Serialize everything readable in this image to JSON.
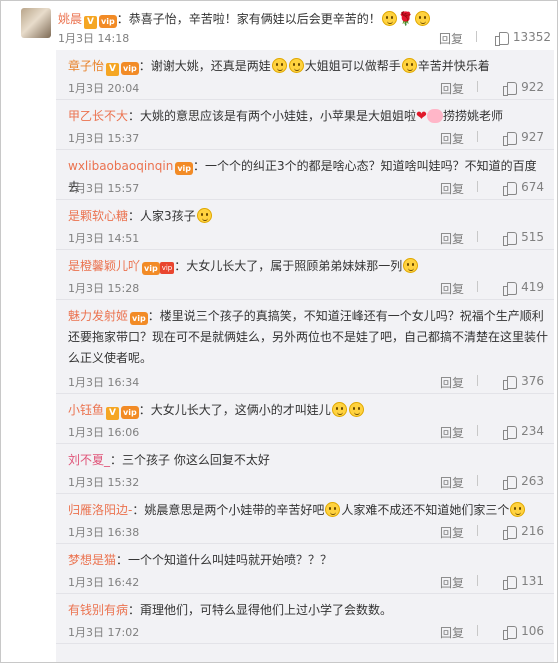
{
  "top_comment": {
    "user": "姚晨",
    "text": "：恭喜子怡，辛苦啦！家有俩娃以后会更辛苦的！",
    "time": "1月3日 14:18",
    "reply_label": "回复",
    "likes": "13352"
  },
  "replies": [
    {
      "user": "章子怡",
      "badge": "V",
      "text": "：谢谢大姚，还真是两娃",
      "text2": "大姐姐可以做帮手",
      "text3": "辛苦并快乐着",
      "time": "1月3日 20:04",
      "reply_label": "回复",
      "likes": "922"
    },
    {
      "user": "甲乙长不大",
      "text": "：大姚的意思应该是有两个小娃娃，小苹果是大姐姐啦",
      "text2": "捞捞姚老师",
      "time": "1月3日 15:37",
      "reply_label": "回复",
      "likes": "927"
    },
    {
      "user": "wxlibaobaoqinqin",
      "text": "：一个个的纠正3个的都是啥心态？知道啥叫娃吗？不知道的百度去",
      "time": "1月3日 15:57",
      "reply_label": "回复",
      "likes": "674"
    },
    {
      "user": "是颗软心糖",
      "text": "：人家3孩子",
      "time": "1月3日 14:51",
      "reply_label": "回复",
      "likes": "515"
    },
    {
      "user": "是橙馨颖儿吖",
      "badge": "vip",
      "text": "：大女儿长大了，属于照顾弟弟妹妹那一列",
      "time": "1月3日 15:28",
      "reply_label": "回复",
      "likes": "419"
    },
    {
      "user": "魅力发射姬",
      "text": "：楼里说三个孩子的真搞笑，不知道汪峰还有一个女儿吗？祝福个生产顺利还要拖家带口？现在可不是就俩娃么，另外两位也不是娃了吧，自己都搞不清楚在这里装什么正义使者呢。",
      "time": "1月3日 16:34",
      "reply_label": "回复",
      "likes": "376"
    },
    {
      "user": "小钰鱼",
      "badge": "V",
      "text": "：大女儿长大了，这俩小的才叫娃儿",
      "time": "1月3日 16:06",
      "reply_label": "回复",
      "likes": "234"
    },
    {
      "user": "刘不夏_",
      "text": "：三个孩子 你这么回复不太好",
      "time": "1月3日 15:32",
      "reply_label": "回复",
      "likes": "263"
    },
    {
      "user": "归雁洛阳边-",
      "text": "：姚晨意思是两个小娃带的辛苦好吧",
      "text2": "人家难不成还不知道她们家三个",
      "time": "1月3日 16:38",
      "reply_label": "回复",
      "likes": "216"
    },
    {
      "user": "梦想是猫",
      "text": "：一个个知道什么叫娃吗就开始喷？？？",
      "time": "1月3日 16:42",
      "reply_label": "回复",
      "likes": "131"
    },
    {
      "user": "有钱别有病",
      "text": "：甭理他们，可特么显得他们上过小学了会数数。",
      "time": "1月3日 17:02",
      "reply_label": "回复",
      "likes": "106"
    }
  ]
}
